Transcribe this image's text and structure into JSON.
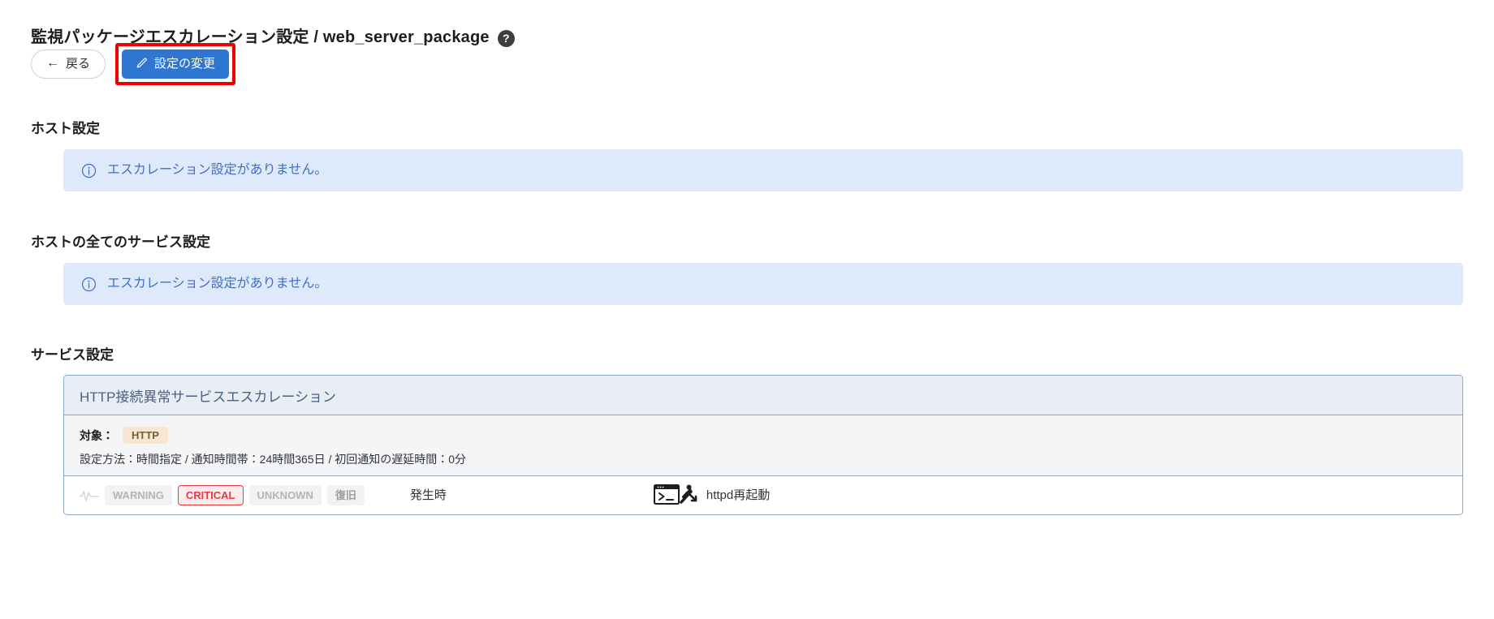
{
  "header": {
    "title": "監視パッケージエスカレーション設定 / web_server_package",
    "help_icon": "question-mark-circle-icon",
    "help_glyph": "?"
  },
  "toolbar": {
    "back_label": "戻る",
    "back_arrow": "←",
    "edit_label": "設定の変更",
    "edit_icon": "pencil-icon",
    "highlight_color": "#ee0000",
    "primary_color": "#2f76d0"
  },
  "sections": {
    "host": {
      "heading": "ホスト設定",
      "info": {
        "icon": "info-circle-icon",
        "text": "エスカレーション設定がありません。",
        "bg_color": "#deeafc",
        "text_color": "#3f6fc4"
      }
    },
    "all_services": {
      "heading": "ホストの全てのサービス設定",
      "info": {
        "icon": "info-circle-icon",
        "text": "エスカレーション設定がありません。",
        "bg_color": "#deeafc",
        "text_color": "#3f6fc4"
      }
    },
    "services": {
      "heading": "サービス設定",
      "cards": [
        {
          "title": "HTTP接続異常サービスエスカレーション",
          "target_label": "対象：",
          "target_badge": "HTTP",
          "target_badge_bg": "#f6e7d2",
          "target_badge_color": "#7a5a32",
          "method_line": "設定方法：時間指定 / 通知時間帯：24時間365日 / 初回通知の遅延時間：0分",
          "action": {
            "wave_icon": "pulse-wave-icon",
            "statuses": [
              {
                "label": "WARNING",
                "state": "off"
              },
              {
                "label": "CRITICAL",
                "state": "on"
              },
              {
                "label": "UNKNOWN",
                "state": "off"
              },
              {
                "label": "復旧",
                "state": "off"
              }
            ],
            "timing": "発生時",
            "command_icon": "terminal-escalate-icon",
            "command_label": "httpd再起動"
          }
        }
      ]
    }
  }
}
